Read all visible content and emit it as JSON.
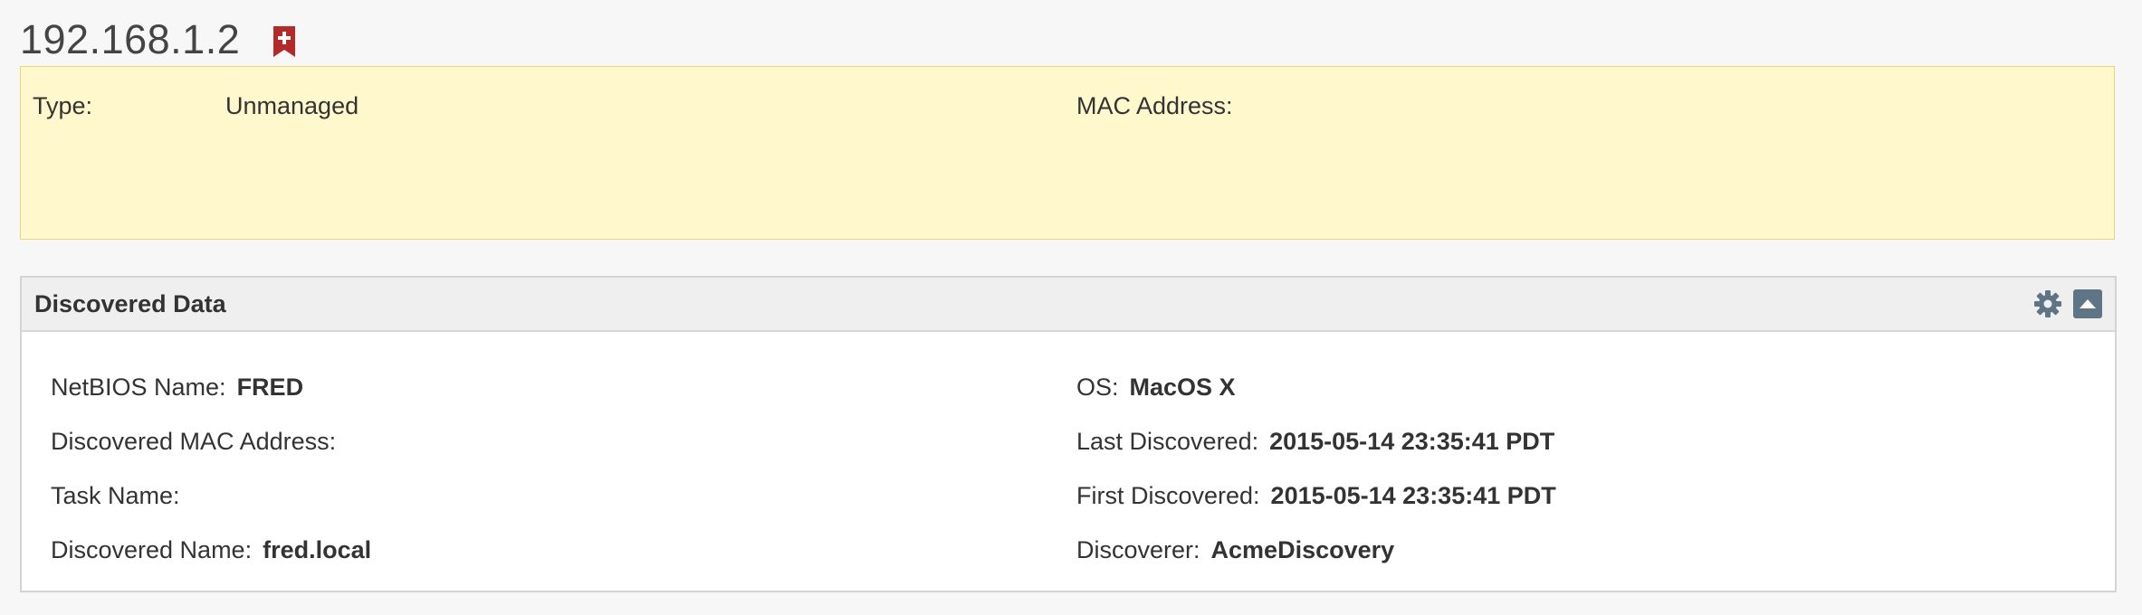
{
  "header": {
    "title": "192.168.1.2",
    "bookmark_icon": "bookmark-plus-icon",
    "bookmark_color": "#b22a2a"
  },
  "summary": {
    "background": "#fef8cc",
    "type_label": "Type:",
    "type_value": "Unmanaged",
    "mac_label": "MAC Address:",
    "mac_value": ""
  },
  "discovered": {
    "title": "Discovered Data",
    "settings_icon": "gear-icon",
    "collapse_icon": "chevron-up-icon",
    "left_fields": [
      {
        "label": "NetBIOS Name:",
        "value": "FRED"
      },
      {
        "label": "Discovered MAC Address:",
        "value": ""
      },
      {
        "label": "Task Name:",
        "value": ""
      },
      {
        "label": "Discovered Name:",
        "value": "fred.local"
      }
    ],
    "right_fields": [
      {
        "label": "OS:",
        "value": "MacOS X"
      },
      {
        "label": "Last Discovered:",
        "value": "2015-05-14 23:35:41 PDT"
      },
      {
        "label": "First Discovered:",
        "value": "2015-05-14 23:35:41 PDT"
      },
      {
        "label": "Discoverer:",
        "value": "AcmeDiscovery"
      }
    ]
  }
}
